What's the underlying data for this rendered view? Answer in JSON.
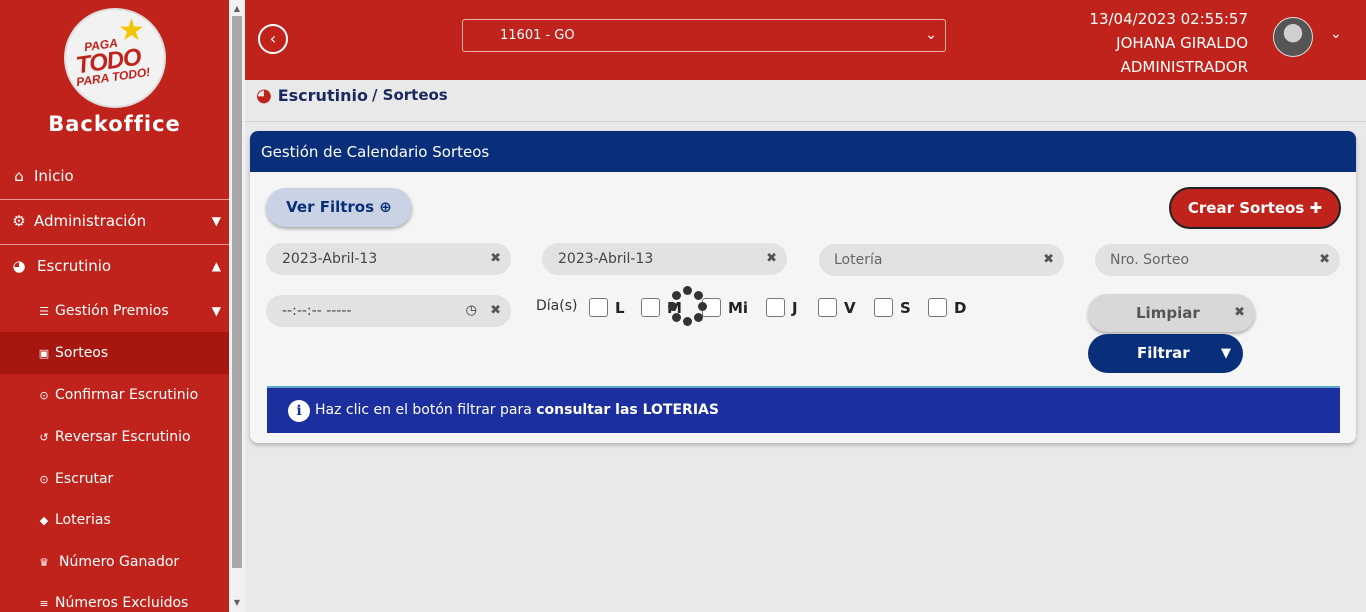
{
  "sidebar": {
    "brand": "Backoffice",
    "logo_text": [
      "PAGA",
      "TODO",
      "PARA TODO!"
    ],
    "items": [
      {
        "label": "Inicio",
        "icon": "home-icon"
      },
      {
        "label": "Administración",
        "icon": "gear-icon"
      },
      {
        "label": "Escrutinio",
        "icon": "pie-chart-icon"
      }
    ],
    "subitems": [
      {
        "label": "Gestión Premios",
        "icon": "sliders-icon"
      },
      {
        "label": "Sorteos",
        "icon": "calendar-icon"
      },
      {
        "label": "Confirmar Escrutinio",
        "icon": "search-icon"
      },
      {
        "label": "Reversar Escrutinio",
        "icon": "undo-icon"
      },
      {
        "label": "Escrutar",
        "icon": "search-icon"
      },
      {
        "label": "Loterias",
        "icon": "ticket-icon"
      },
      {
        "label": "Número Ganador",
        "icon": "trophy-icon"
      },
      {
        "label": "Números Excluidos",
        "icon": "list-icon"
      }
    ]
  },
  "header": {
    "branch": "11601 - GO",
    "datetime": "13/04/2023 02:55:57",
    "user_name": "JOHANA GIRALDO",
    "user_role": "ADMINISTRADOR"
  },
  "breadcrumb": {
    "section": "Escrutinio",
    "page": "/ Sorteos"
  },
  "card": {
    "title": "Gestión de Calendario Sorteos",
    "filters_button": "Ver Filtros",
    "create_button": "Crear Sorteos",
    "date_from": "2023-Abril-13",
    "date_to": "2023-Abril-13",
    "lottery_placeholder": "Lotería",
    "draw_number_placeholder": "Nro. Sorteo",
    "time_placeholder": "--:--:-- -----",
    "days_label": "Día(s)",
    "days": [
      "L",
      "M",
      "Mi",
      "J",
      "V",
      "S",
      "D"
    ],
    "clear_button": "Limpiar",
    "filter_button": "Filtrar",
    "info_text": "Haz clic en el botón filtrar para ",
    "info_bold": "consultar las LOTERIAS"
  },
  "colors": {
    "primary_red": "#c0231b",
    "navy": "#0a2f7a",
    "info_blue": "#1c2f9e"
  }
}
